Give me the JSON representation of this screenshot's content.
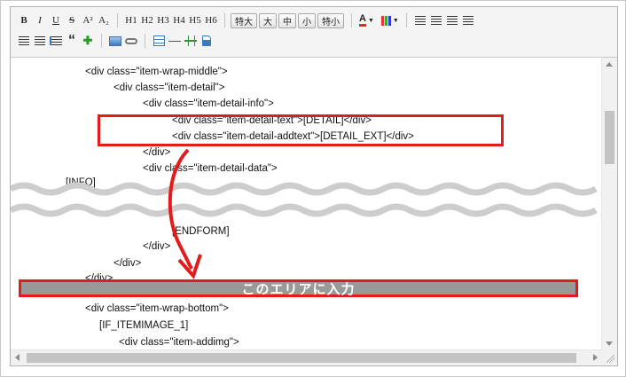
{
  "toolbar": {
    "row1": {
      "bold": "B",
      "italic": "I",
      "underline": "U",
      "strike": "S",
      "superscript": "A²",
      "subscript": "A₂",
      "headings": [
        "H1",
        "H2",
        "H3",
        "H4",
        "H5",
        "H6"
      ],
      "sizes": [
        "特大",
        "大",
        "中",
        "小",
        "特小"
      ],
      "text_color": "A"
    },
    "row2": {
      "quote": "“"
    }
  },
  "code_lines": [
    "<div class=\"item-wrap-middle\">",
    "<div class=\"item-detail\">",
    "<div class=\"item-detail-info\">",
    "<div class=\"item-detail-text\">[DETAIL]</div>",
    "<div class=\"item-detail-addtext\">[DETAIL_EXT]</div>",
    "</div>",
    "<div class=\"item-detail-data\">",
    "[INFO]",
    "[ENDFORM]",
    "</div>",
    "</div>",
    "</div>",
    "<div class=\"item-wrap-bottom\">",
    "[IF_ITEMIMAGE_1]",
    "<div class=\"item-addimg\">"
  ],
  "annotation": {
    "input_area_label": "このエリアに入力",
    "highlight_color": "#e31b1b",
    "bar_color": "#999999"
  }
}
